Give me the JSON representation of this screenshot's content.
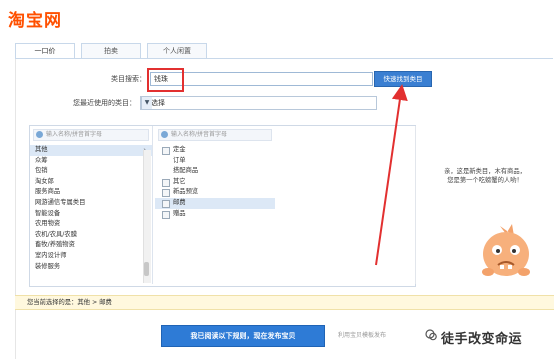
{
  "logo_text": "淘宝网",
  "tabs": [
    {
      "label": "一口价"
    },
    {
      "label": "拍卖"
    },
    {
      "label": "个人闲置"
    }
  ],
  "category_search": {
    "label": "类目搜索：",
    "value": "钱珠",
    "button": "快速找到类目"
  },
  "recent": {
    "label": "您最近使用的类目：",
    "value": "请选择"
  },
  "search_placeholder": "输入名称/拼音首字母",
  "left_list": [
    {
      "label": "其他",
      "selected": true
    },
    {
      "label": "众筹"
    },
    {
      "label": "包销"
    },
    {
      "label": "淘女郎"
    },
    {
      "label": "服务商品"
    },
    {
      "label": "网游通信专属类目"
    },
    {
      "label": "智能设备"
    },
    {
      "label": "农用物资"
    },
    {
      "label": "农机/农具/农膜"
    },
    {
      "label": "畜牧/养殖物资"
    },
    {
      "label": "室内设计师"
    },
    {
      "label": "装修服务"
    }
  ],
  "middle_list": [
    {
      "label": "定金"
    },
    {
      "label": "订单"
    },
    {
      "label": "搭配商品"
    },
    {
      "label": "其它"
    },
    {
      "label": "新品预览"
    },
    {
      "label": "邮费",
      "selected": true
    },
    {
      "label": "赠品"
    }
  ],
  "new_category_msg": {
    "line1": "亲，这是新类目，木有商品，",
    "line2": "您是第一个吃螃蟹的人哟！"
  },
  "selected_path": {
    "label": "您当前选择的是：",
    "path": "其他 > 邮费"
  },
  "publish_button": "我已阅读以下规则，现在发布宝贝",
  "template_link": "利用宝贝模板发布",
  "watermark": "徒手改变命运",
  "colors": {
    "accent": "#3a7fd2",
    "brand": "#ff5000",
    "highlight": "#e23030"
  }
}
